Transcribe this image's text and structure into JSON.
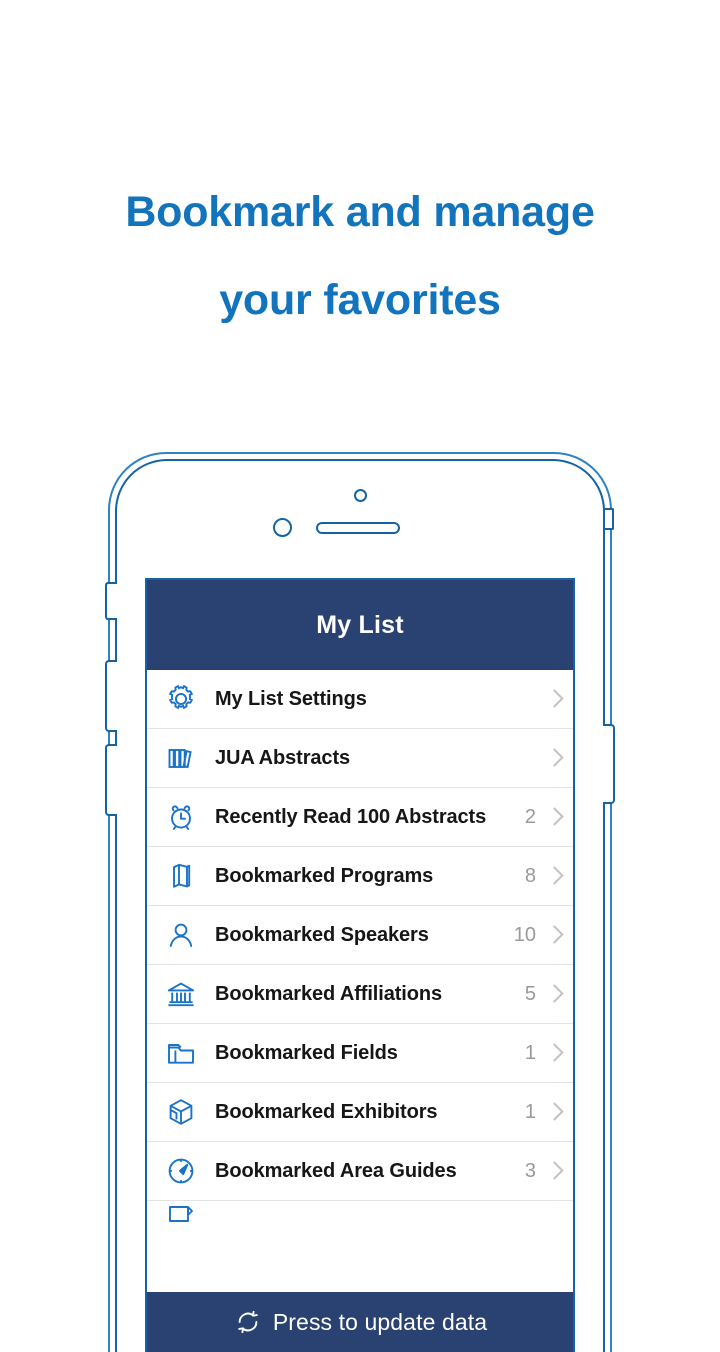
{
  "headline": {
    "line1": "Bookmark and manage",
    "line2": "your favorites",
    "color": "#1274bc"
  },
  "colors": {
    "navy": "#2a4272",
    "accent_blue": "#1274bc",
    "icon_blue": "#1a73c8",
    "outline_blue": "#1464a5",
    "bezel_blue": "#2e83c4",
    "chevron_gray": "#c2c2c2",
    "count_gray": "#9a9a9a",
    "row_text": "#161616",
    "divider": "#e3e3e3",
    "screen_bg": "#ffffff",
    "page_bg": "#ffffff"
  },
  "phone": {
    "hardware": {
      "camera": "camera-dot",
      "sensor": "sensor-dot",
      "speaker": "speaker-slot",
      "buttons": [
        "mute-switch",
        "volume-up-button",
        "volume-down-button",
        "power-button",
        "sim-tray"
      ]
    }
  },
  "screen": {
    "navbar": {
      "title": "My List"
    },
    "list": {
      "rows": [
        {
          "icon": "gear-icon",
          "label": "My List Settings",
          "count": "",
          "chevron": true
        },
        {
          "icon": "books-icon",
          "label": "JUA Abstracts",
          "count": "",
          "chevron": true
        },
        {
          "icon": "alarm-clock-icon",
          "label": "Recently Read 100 Abstracts",
          "count": "2",
          "chevron": true
        },
        {
          "icon": "book-icon",
          "label": "Bookmarked Programs",
          "count": "8",
          "chevron": true
        },
        {
          "icon": "person-icon",
          "label": "Bookmarked Speakers",
          "count": "10",
          "chevron": true
        },
        {
          "icon": "bank-icon",
          "label": "Bookmarked Affiliations",
          "count": "5",
          "chevron": true
        },
        {
          "icon": "folder-icon",
          "label": "Bookmarked Fields",
          "count": "1",
          "chevron": true
        },
        {
          "icon": "cube-icon",
          "label": "Bookmarked Exhibitors",
          "count": "1",
          "chevron": true
        },
        {
          "icon": "compass-icon",
          "label": "Bookmarked Area Guides",
          "count": "3",
          "chevron": true
        }
      ]
    },
    "update_bar": {
      "icon": "sync-icon",
      "label": "Press to update data"
    }
  }
}
